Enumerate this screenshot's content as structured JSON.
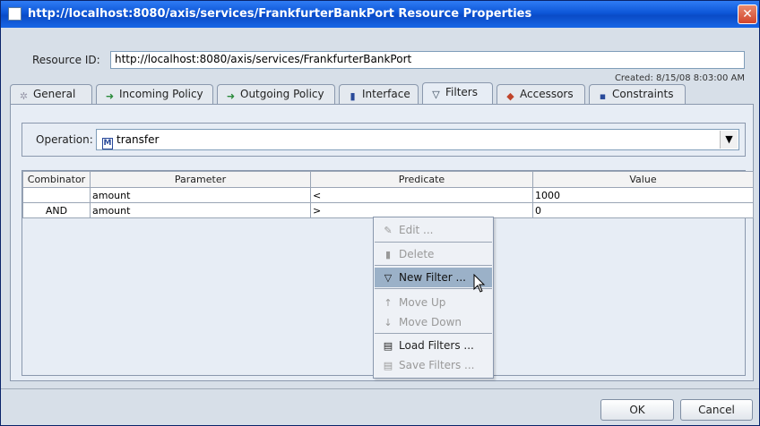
{
  "window": {
    "title": "http://localhost:8080/axis/services/FrankfurterBankPort Resource Properties",
    "close": "✕"
  },
  "resource": {
    "label": "Resource ID:",
    "value": "http://localhost:8080/axis/services/FrankfurterBankPort",
    "created": "Created: 8/15/08 8:03:00 AM"
  },
  "tabs": [
    {
      "label": "General",
      "icon": "gear-icon",
      "glyph": "✲"
    },
    {
      "label": "Incoming Policy",
      "icon": "incoming-arrow-icon",
      "glyph": "➜"
    },
    {
      "label": "Outgoing Policy",
      "icon": "outgoing-arrow-icon",
      "glyph": "➜"
    },
    {
      "label": "Interface",
      "icon": "interface-icon",
      "glyph": "▮"
    },
    {
      "label": "Filters",
      "icon": "filter-icon",
      "glyph": "▽"
    },
    {
      "label": "Accessors",
      "icon": "accessors-icon",
      "glyph": "◆"
    },
    {
      "label": "Constraints",
      "icon": "constraints-icon",
      "glyph": "▪"
    }
  ],
  "operation": {
    "label": "Operation:",
    "value": "transfer"
  },
  "table": {
    "columns": [
      "Combinator",
      "Parameter",
      "Predicate",
      "Value"
    ],
    "rows": [
      {
        "combinator": "",
        "parameter": "amount",
        "predicate": "<",
        "value": "1000"
      },
      {
        "combinator": "AND",
        "parameter": "amount",
        "predicate": ">",
        "value": "0"
      }
    ]
  },
  "context_menu": [
    {
      "label": "Edit ...",
      "icon": "pencil-icon",
      "glyph": "✎",
      "enabled": false
    },
    {
      "label": "Delete",
      "icon": "trash-icon",
      "glyph": "▮",
      "enabled": false
    },
    {
      "label": "New Filter ...",
      "icon": "new-filter-icon",
      "glyph": "▽",
      "enabled": true,
      "highlighted": true
    },
    {
      "label": "Move Up",
      "icon": "arrow-up-icon",
      "glyph": "↑",
      "enabled": false
    },
    {
      "label": "Move Down",
      "icon": "arrow-down-icon",
      "glyph": "↓",
      "enabled": false
    },
    {
      "label": "Load Filters ...",
      "icon": "load-icon",
      "glyph": "▤",
      "enabled": true
    },
    {
      "label": "Save Filters ...",
      "icon": "save-icon",
      "glyph": "▤",
      "enabled": false
    }
  ],
  "buttons": {
    "ok": "OK",
    "cancel": "Cancel"
  },
  "colors": {
    "titlebar": "#0d56d8",
    "menu_highlight": "#9bb1c8",
    "panel": "#e7edf5"
  }
}
